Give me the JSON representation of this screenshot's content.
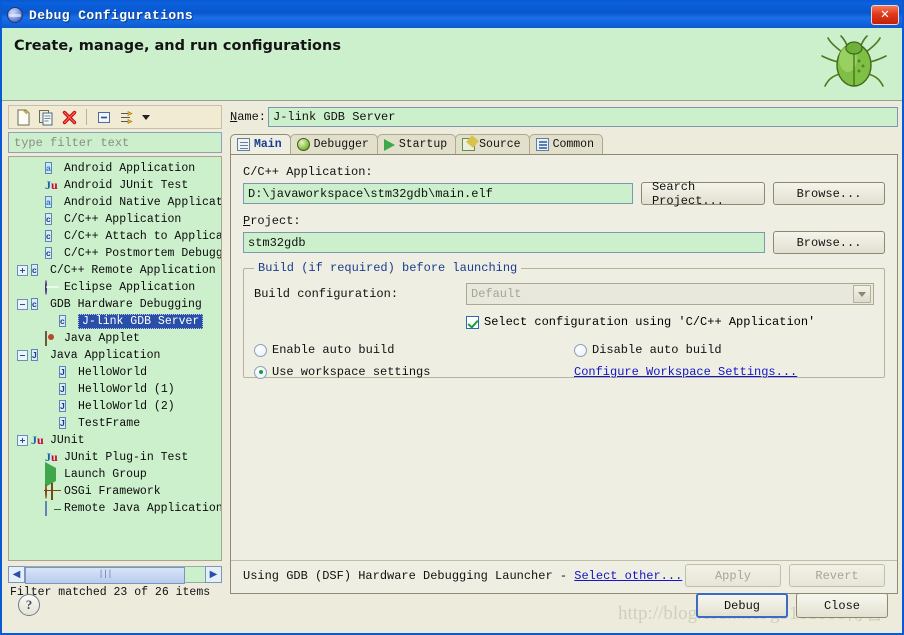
{
  "window": {
    "title": "Debug Configurations",
    "icon": "debug-config-icon",
    "close_label": "✕"
  },
  "header": {
    "title": "Create, manage, and run configurations",
    "decoration_icon": "green-bug-icon"
  },
  "toolbar": {
    "buttons": [
      {
        "name": "new-configuration",
        "icon": "new-document-icon"
      },
      {
        "name": "duplicate-configuration",
        "icon": "copy-icon"
      },
      {
        "name": "delete-configuration",
        "icon": "red-x-icon"
      },
      {
        "name": "collapse-all",
        "icon": "collapse-all-icon"
      },
      {
        "name": "filter-configurations",
        "icon": "filter-icon"
      }
    ],
    "dropdown_icon": "chevron-down-icon"
  },
  "filter": {
    "placeholder": "type filter text",
    "value": "",
    "status": "Filter matched 23 of 26 items"
  },
  "tree": {
    "items": [
      {
        "label": "Android Application",
        "indent": 1,
        "twisty": "none",
        "icon": "android-icon",
        "selected": false
      },
      {
        "label": "Android JUnit Test",
        "indent": 1,
        "twisty": "none",
        "icon": "junit-icon",
        "selected": false
      },
      {
        "label": "Android Native Application",
        "indent": 1,
        "twisty": "none",
        "icon": "android-icon",
        "selected": false
      },
      {
        "label": "C/C++ Application",
        "indent": 1,
        "twisty": "none",
        "icon": "c-file-icon",
        "selected": false
      },
      {
        "label": "C/C++ Attach to Applicatio",
        "indent": 1,
        "twisty": "none",
        "icon": "c-file-icon",
        "selected": false
      },
      {
        "label": "C/C++ Postmortem Debugger",
        "indent": 1,
        "twisty": "none",
        "icon": "c-file-icon",
        "selected": false
      },
      {
        "label": "C/C++ Remote Application",
        "indent": 0,
        "twisty": "plus",
        "icon": "c-file-icon",
        "selected": false
      },
      {
        "label": "Eclipse Application",
        "indent": 1,
        "twisty": "none",
        "icon": "eclipse-globe-icon",
        "selected": false
      },
      {
        "label": "GDB Hardware Debugging",
        "indent": 0,
        "twisty": "minus",
        "icon": "c-file-icon",
        "selected": false
      },
      {
        "label": "J-link GDB Server",
        "indent": 2,
        "twisty": "none",
        "icon": "c-file-icon",
        "selected": true
      },
      {
        "label": "Java Applet",
        "indent": 1,
        "twisty": "none",
        "icon": "java-applet-icon",
        "selected": false
      },
      {
        "label": "Java Application",
        "indent": 0,
        "twisty": "minus",
        "icon": "java-icon",
        "selected": false
      },
      {
        "label": "HelloWorld",
        "indent": 2,
        "twisty": "none",
        "icon": "java-icon",
        "selected": false
      },
      {
        "label": "HelloWorld (1)",
        "indent": 2,
        "twisty": "none",
        "icon": "java-icon",
        "selected": false
      },
      {
        "label": "HelloWorld (2)",
        "indent": 2,
        "twisty": "none",
        "icon": "java-icon",
        "selected": false
      },
      {
        "label": "TestFrame",
        "indent": 2,
        "twisty": "none",
        "icon": "java-icon",
        "selected": false
      },
      {
        "label": "JUnit",
        "indent": 0,
        "twisty": "plus",
        "icon": "junit-icon",
        "selected": false
      },
      {
        "label": "JUnit Plug-in Test",
        "indent": 1,
        "twisty": "none",
        "icon": "junit-plugin-icon",
        "selected": false
      },
      {
        "label": "Launch Group",
        "indent": 1,
        "twisty": "none",
        "icon": "launch-group-icon",
        "selected": false
      },
      {
        "label": "OSGi Framework",
        "indent": 1,
        "twisty": "none",
        "icon": "osgi-icon",
        "selected": false
      },
      {
        "label": "Remote Java Application",
        "indent": 1,
        "twisty": "none",
        "icon": "remote-java-icon",
        "selected": false
      }
    ],
    "scroll_left_icon": "◀",
    "scroll_right_icon": "▶"
  },
  "config": {
    "name_label": "Name:",
    "name_label_mnemonic": "N",
    "name_value": "J-link GDB Server",
    "tabs": [
      {
        "label": "Main",
        "icon": "document-icon",
        "active": true
      },
      {
        "label": "Debugger",
        "icon": "bug-icon",
        "active": false
      },
      {
        "label": "Startup",
        "icon": "play-icon",
        "active": false
      },
      {
        "label": "Source",
        "icon": "source-icon",
        "active": false
      },
      {
        "label": "Common",
        "icon": "common-icon",
        "active": false
      }
    ],
    "application_label": "C/C++ Application:",
    "application_value": "D:\\javaworkspace\\stm32gdb\\main.elf",
    "search_project_button": "Search Project...",
    "browse_button_1": "Browse...",
    "project_label": "Project:",
    "project_value": "stm32gdb",
    "browse_button_2": "Browse...",
    "build_group_title": "Build (if required) before launching",
    "build_config_label": "Build configuration:",
    "build_config_value": "Default",
    "select_config_checkbox": "Select configuration using 'C/C++ Application'",
    "select_config_checked": true,
    "radio_enable_auto_build": "Enable auto build",
    "radio_disable_auto_build": "Disable auto build",
    "radio_use_workspace": "Use workspace settings",
    "configure_workspace_link": "Configure Workspace Settings...",
    "selected_radio": "use_workspace",
    "status_text": "Using GDB (DSF) Hardware Debugging Launcher -",
    "select_other_link": "Select other...",
    "apply_button": "Apply",
    "revert_button": "Revert",
    "apply_enabled": false,
    "revert_enabled": false
  },
  "footer": {
    "help_icon": "question-mark-icon",
    "help_glyph": "?",
    "debug_button": "Debug",
    "close_button": "Close",
    "watermark": "http://blog.csdn.net/g5101088博客"
  },
  "colors": {
    "titlebar_blue": "#0A56CC",
    "header_green": "#CCEFCC",
    "panel_cream": "#EFEEE2",
    "dialog_bg": "#ECEBDC",
    "input_green": "#CCEFCC",
    "selection_blue": "#2A4FA8",
    "link_blue": "#1414C8",
    "group_title_blue": "#1A3C8F"
  }
}
